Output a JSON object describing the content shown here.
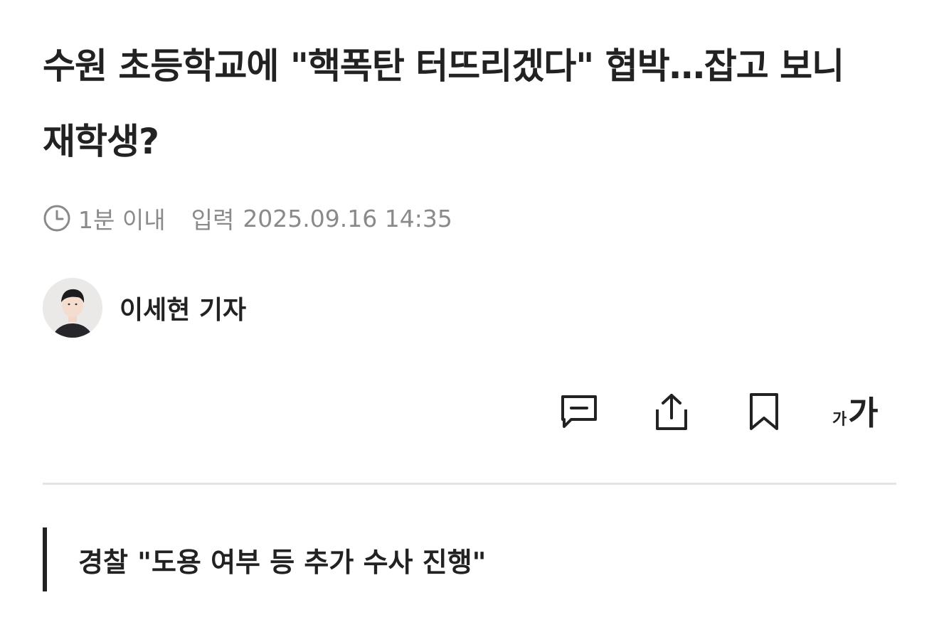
{
  "article": {
    "headline": "수원 초등학교에 \"핵폭탄 터뜨리겠다\" 협박…잡고 보니 재학생?",
    "meta": {
      "clock_icon": "clock-icon",
      "elapsed": "1분 이내",
      "published_label": "입력",
      "published_at": "2025.09.16 14:35"
    },
    "byline": {
      "author": "이세현 기자"
    },
    "toolbar": {
      "comment_icon": "comment-icon",
      "share_icon": "share-icon",
      "bookmark_icon": "bookmark-icon",
      "font_small": "가",
      "font_large": "가"
    },
    "subtitle": "경찰 \"도용 여부 등 추가 수사 진행\""
  },
  "colors": {
    "text": "#222222",
    "meta_text": "#8a8a8a",
    "divider": "#e4e4e4"
  }
}
